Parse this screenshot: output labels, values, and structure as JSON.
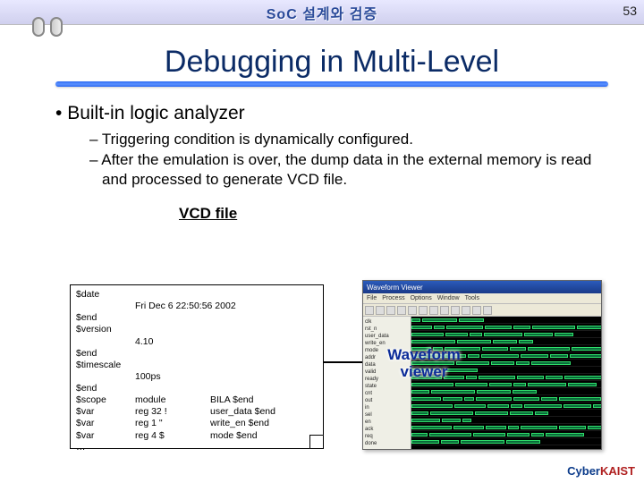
{
  "header": {
    "title_korean": "SoC 설계와 검증"
  },
  "page_number": "53",
  "slide": {
    "title": "Debugging in Multi-Level",
    "bullet1": "Built-in logic analyzer",
    "sub1": "Triggering condition is dynamically configured.",
    "sub2": "After the emulation is over, the dump data in the external memory is read and processed to generate VCD file."
  },
  "vcd": {
    "title": "VCD file",
    "date_key": "$date",
    "date_val": "Fri Dec 6 22:50:56 2002",
    "end1": "$end",
    "version_key": "$version",
    "version_val": "4.10",
    "end2": "$end",
    "timescale_key": "$timescale",
    "timescale_val": "100ps",
    "end3": "$end",
    "scope_key": "$scope",
    "scope_mod": "module",
    "scope_name": "BILA $end",
    "var1_key": "$var",
    "var1_type": "reg 32 !",
    "var1_name": "user_data $end",
    "var2_key": "$var",
    "var2_type": "reg 1 \"",
    "var2_name": "write_en $end",
    "var3_key": "$var",
    "var3_type": "reg 4 $",
    "var3_name": "mode $end",
    "ellipsis": "…"
  },
  "waveform": {
    "label_line1": "Waveform",
    "label_line2": "viewer",
    "window_title": "Waveform Viewer",
    "menu": [
      "File",
      "Process",
      "Options",
      "Window",
      "Tools"
    ],
    "signals": [
      "clk",
      "rst_n",
      "user_data",
      "write_en",
      "mode",
      "addr",
      "data",
      "valid",
      "ready",
      "state",
      "cnt",
      "out",
      "in",
      "sel",
      "en",
      "ack",
      "req",
      "done"
    ]
  },
  "logo": {
    "prefix": "Cyber",
    "kaist": "KAIST"
  }
}
